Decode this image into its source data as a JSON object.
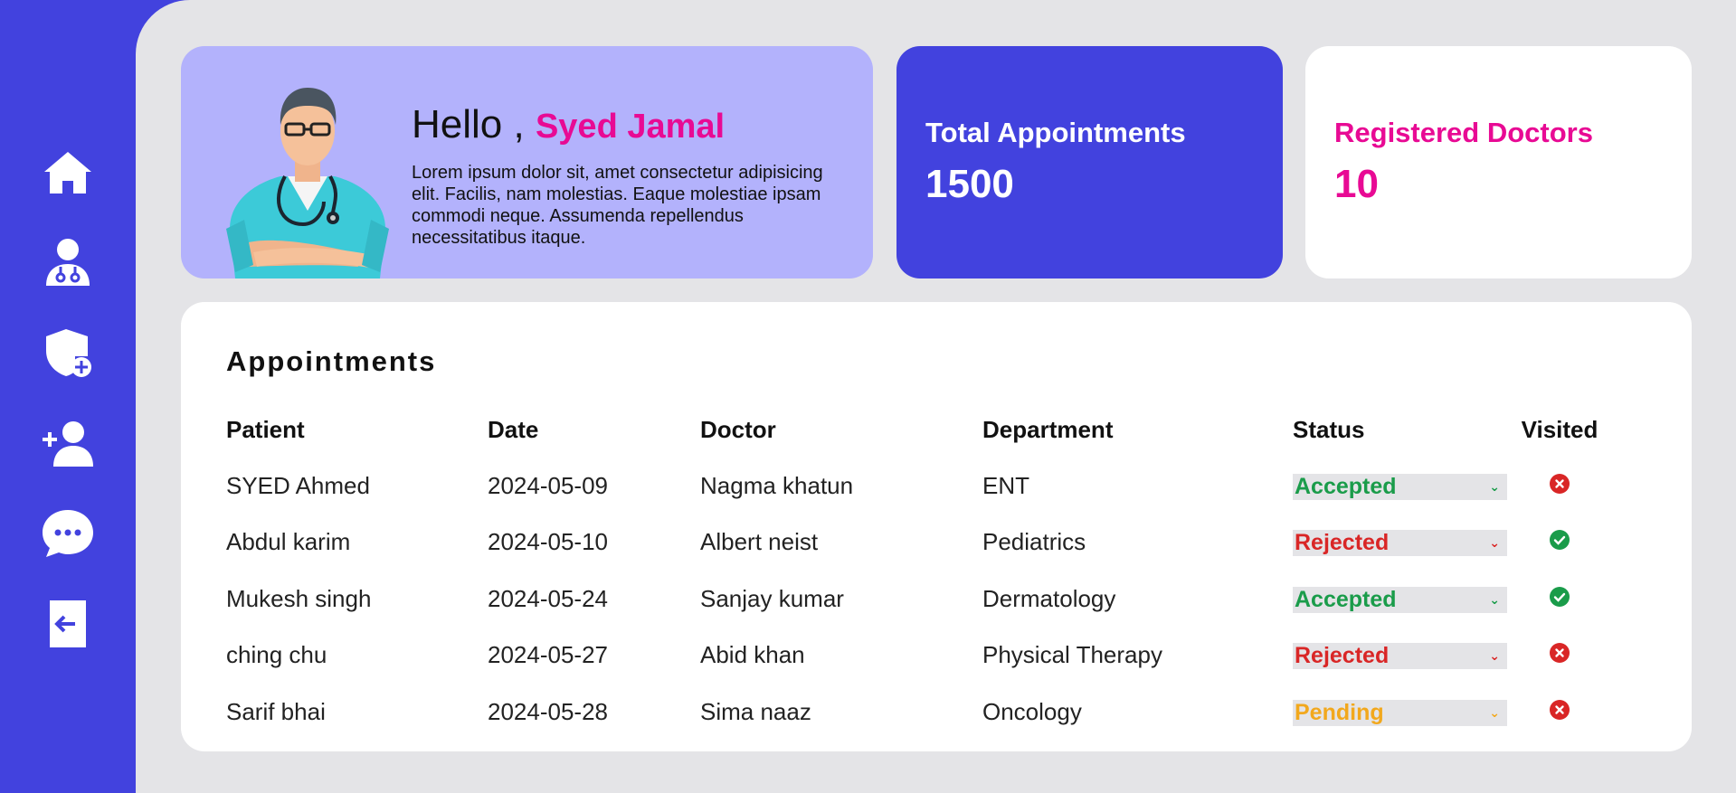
{
  "sidebar": {
    "items": [
      {
        "name": "home-icon"
      },
      {
        "name": "doctor-icon"
      },
      {
        "name": "shield-plus-icon"
      },
      {
        "name": "add-user-icon"
      },
      {
        "name": "chat-bubble-icon"
      },
      {
        "name": "logout-icon"
      }
    ]
  },
  "welcome": {
    "greeting": "Hello ,",
    "user_name": "Syed Jamal",
    "message": "Lorem ipsum dolor sit, amet consectetur adipisicing elit. Facilis, nam molestias. Eaque molestiae ipsam commodi neque. Assumenda repellendus necessitatibus itaque."
  },
  "stats": {
    "total_appointments": {
      "label": "Total Appointments",
      "value": "1500"
    },
    "registered_doctors": {
      "label": "Registered Doctors",
      "value": "10"
    }
  },
  "appointments": {
    "title": "Appointments",
    "columns": [
      "Patient",
      "Date",
      "Doctor",
      "Department",
      "Status",
      "Visited"
    ],
    "rows": [
      {
        "patient": "SYED Ahmed",
        "date": "2024-05-09",
        "doctor": "Nagma khatun",
        "department": "ENT",
        "status": "Accepted",
        "visited": false
      },
      {
        "patient": "Abdul karim",
        "date": "2024-05-10",
        "doctor": "Albert neist",
        "department": "Pediatrics",
        "status": "Rejected",
        "visited": true
      },
      {
        "patient": "Mukesh singh",
        "date": "2024-05-24",
        "doctor": "Sanjay kumar",
        "department": "Dermatology",
        "status": "Accepted",
        "visited": true
      },
      {
        "patient": "ching chu",
        "date": "2024-05-27",
        "doctor": "Abid khan",
        "department": "Physical Therapy",
        "status": "Rejected",
        "visited": false
      },
      {
        "patient": "Sarif bhai",
        "date": "2024-05-28",
        "doctor": "Sima naaz",
        "department": "Oncology",
        "status": "Pending",
        "visited": false
      }
    ]
  },
  "colors": {
    "accent": "#4242de",
    "highlight": "#e80a94",
    "accepted": "#1a9c4a",
    "rejected": "#d92626",
    "pending": "#f2a81d"
  }
}
